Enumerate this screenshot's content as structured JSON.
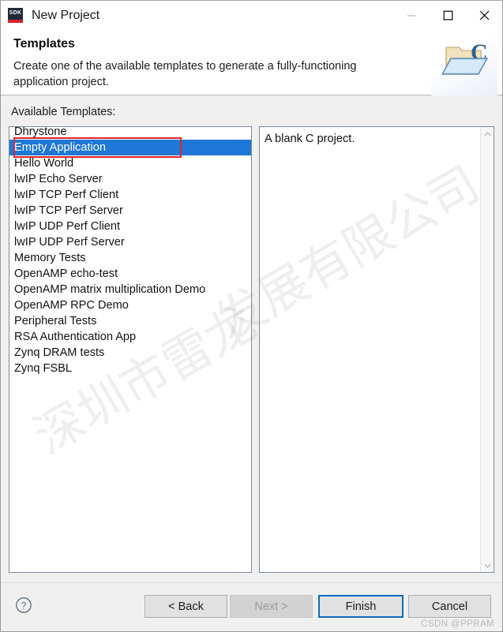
{
  "window": {
    "title": "New Project",
    "app_icon_label": "SDK",
    "controls": {
      "minimize": "minimize-icon",
      "maximize": "maximize-icon",
      "close": "close-icon"
    }
  },
  "banner": {
    "title": "Templates",
    "description": "Create one of the available templates to generate a fully-functioning application project.",
    "icon": "c-project-folder-icon"
  },
  "content": {
    "available_label": "Available Templates:",
    "templates": [
      "Dhrystone",
      "Empty Application",
      "Hello World",
      "lwIP Echo Server",
      "lwIP TCP Perf Client",
      "lwIP TCP Perf Server",
      "lwIP UDP Perf Client",
      "lwIP UDP Perf Server",
      "Memory Tests",
      "OpenAMP echo-test",
      "OpenAMP matrix multiplication Demo",
      "OpenAMP RPC Demo",
      "Peripheral Tests",
      "RSA Authentication App",
      "Zynq DRAM tests",
      "Zynq FSBL"
    ],
    "selected_template": "Empty Application",
    "description_text": "A blank C project."
  },
  "watermarks": {
    "company": "深圳市雷龙发展有限公司",
    "part1": "深圳市雷龙",
    "part2": "发展有限公司",
    "csdn": "CSDN @PPRAM"
  },
  "footer": {
    "help": "?",
    "back": "< Back",
    "next": "Next >",
    "finish": "Finish",
    "cancel": "Cancel"
  },
  "colors": {
    "selection_blue": "#1e78d7",
    "annotation_red": "#e8212a",
    "default_button_border": "#0f6cbd",
    "accent_red": "#d8232a"
  }
}
